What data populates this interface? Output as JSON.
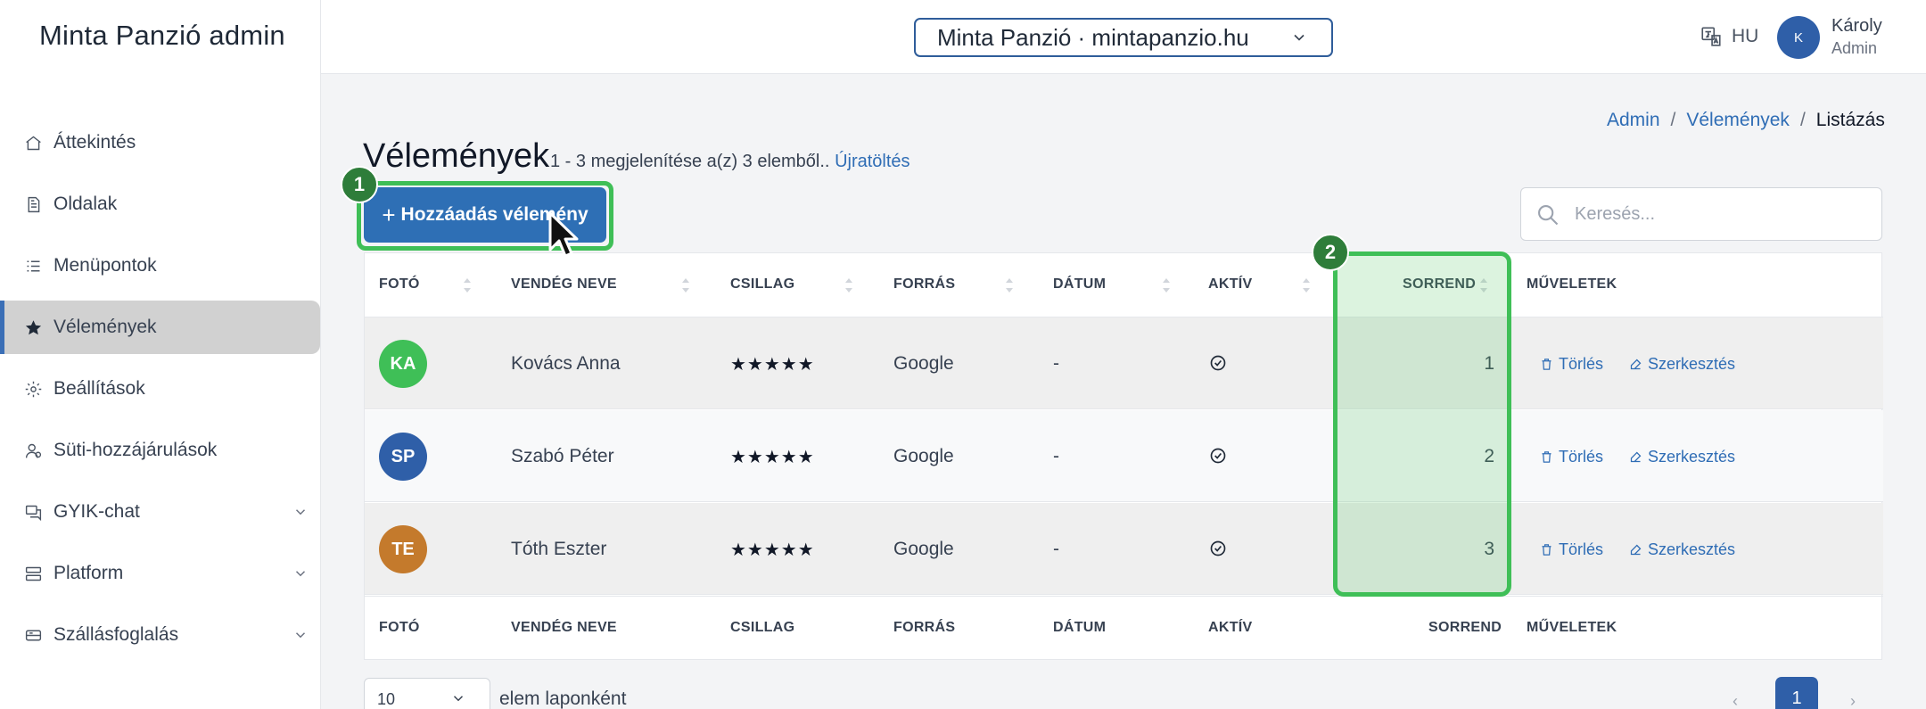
{
  "brand": "Minta Panzió admin",
  "nav": [
    {
      "label": "Áttekintés",
      "icon": "home-icon"
    },
    {
      "label": "Oldalak",
      "icon": "document-icon"
    },
    {
      "label": "Menüpontok",
      "icon": "list-icon"
    },
    {
      "label": "Vélemények",
      "icon": "star-icon",
      "active": true
    },
    {
      "label": "Beállítások",
      "icon": "gear-icon"
    },
    {
      "label": "Süti-hozzájárulások",
      "icon": "user-icon"
    },
    {
      "label": "GYIK-chat",
      "icon": "chat-icon",
      "expandable": true
    },
    {
      "label": "Platform",
      "icon": "layers-icon",
      "expandable": true
    },
    {
      "label": "Szállásfoglalás",
      "icon": "bed-icon",
      "expandable": true
    }
  ],
  "topbar": {
    "site_select": "Minta Panzió · mintapanzio.hu",
    "lang": "HU",
    "user_initial": "K",
    "user_name": "Károly",
    "user_role": "Admin"
  },
  "breadcrumb": [
    "Admin",
    "Vélemények",
    "Listázás"
  ],
  "page": {
    "title": "Vélemények",
    "subtitle": "1 - 3 megjelenítése a(z) 3 elemből..",
    "reload": "Újratöltés",
    "add_button": "Hozzáadás vélemény",
    "search_placeholder": "Keresés..."
  },
  "annotations": {
    "badge_1": "1",
    "badge_2": "2"
  },
  "table": {
    "columns": [
      "FOTÓ",
      "VENDÉG NEVE",
      "CSILLAG",
      "FORRÁS",
      "DÁTUM",
      "AKTÍV",
      "SORREND",
      "MŰVELETEK"
    ],
    "rows": [
      {
        "initials": "KA",
        "color": "#3fbf57",
        "name": "Kovács Anna",
        "stars": "★★★★★",
        "source": "Google",
        "date": "-",
        "order": "1"
      },
      {
        "initials": "SP",
        "color": "#2f5fa8",
        "name": "Szabó Péter",
        "stars": "★★★★★",
        "source": "Google",
        "date": "-",
        "order": "2"
      },
      {
        "initials": "TE",
        "color": "#c47a2c",
        "name": "Tóth Eszter",
        "stars": "★★★★★",
        "source": "Google",
        "date": "-",
        "order": "3"
      }
    ],
    "delete_label": "Törlés",
    "edit_label": "Szerkesztés"
  },
  "footer": {
    "per_page_value": "10",
    "per_page_label": "elem laponként",
    "prev": "‹",
    "current_page": "1",
    "next": "›"
  }
}
